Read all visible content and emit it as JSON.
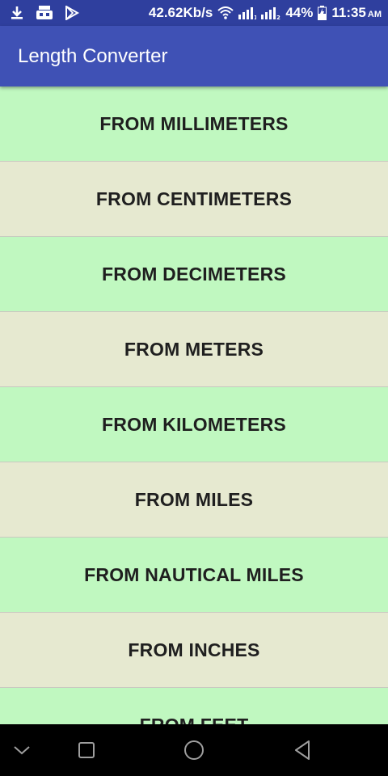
{
  "status_bar": {
    "speed": "42.62Kb/s",
    "battery": "44%",
    "time": "11:35",
    "ampm": "AM",
    "icons": [
      "download-icon",
      "robot-icon",
      "play-store-icon",
      "wifi-icon",
      "signal-sim1-icon",
      "signal-sim2-icon",
      "battery-charging-icon"
    ]
  },
  "app_bar": {
    "title": "Length Converter"
  },
  "units": [
    {
      "label": "FROM MILLIMETERS"
    },
    {
      "label": "FROM CENTIMETERS"
    },
    {
      "label": "FROM DECIMETERS"
    },
    {
      "label": "FROM METERS"
    },
    {
      "label": "FROM KILOMETERS"
    },
    {
      "label": "FROM MILES"
    },
    {
      "label": "FROM NAUTICAL MILES"
    },
    {
      "label": "FROM INCHES"
    },
    {
      "label": "FROM FEET"
    }
  ],
  "colors": {
    "status_bar": "#2f3f9e",
    "app_bar": "#3f51b5",
    "row_green": "#c0f8c0",
    "row_beige": "#e6e9d0"
  },
  "nav_bar": {
    "icons": [
      "chevron-down-icon",
      "recents-square-icon",
      "home-circle-icon",
      "back-triangle-icon"
    ]
  }
}
